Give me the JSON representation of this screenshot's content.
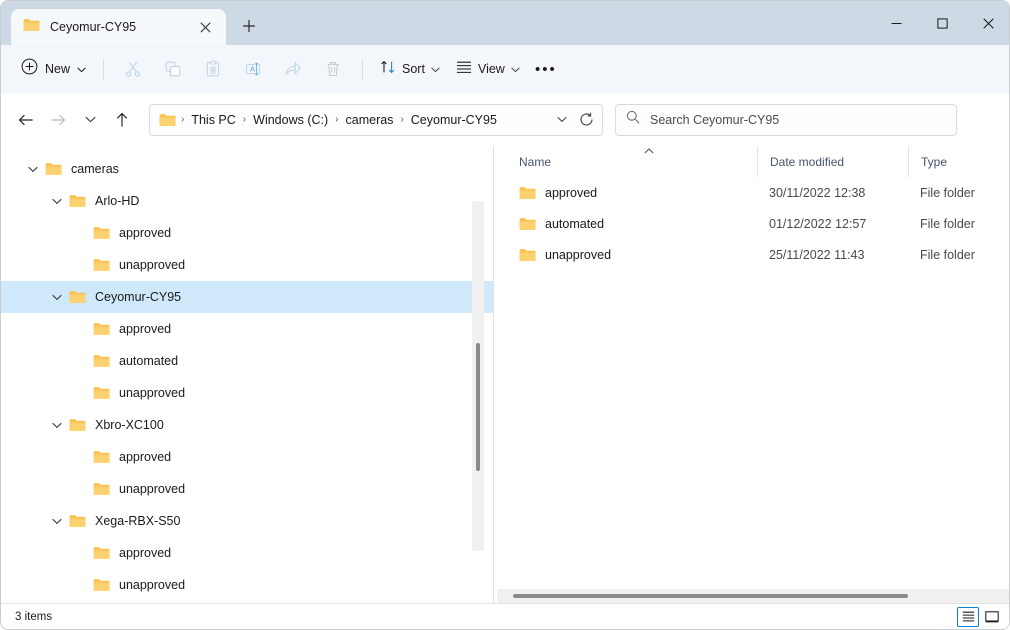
{
  "window": {
    "tab_title": "Ceyomur-CY95",
    "controls": {
      "minimize": "minimize-icon",
      "maximize": "maximize-icon",
      "close": "close-icon"
    },
    "new_tab_label": "+"
  },
  "toolbar": {
    "new_label": "New",
    "sort_label": "Sort",
    "view_label": "View",
    "more_label": "•••",
    "icons": [
      {
        "name": "cut-icon",
        "disabled": true
      },
      {
        "name": "copy-icon",
        "disabled": true
      },
      {
        "name": "paste-icon",
        "disabled": true
      },
      {
        "name": "rename-icon",
        "disabled": true
      },
      {
        "name": "share-icon",
        "disabled": true
      },
      {
        "name": "delete-icon",
        "disabled": true
      }
    ]
  },
  "address": {
    "back": "back-arrow-icon",
    "forward": "forward-arrow-icon",
    "recent": "chevron-down-icon",
    "up": "up-arrow-icon",
    "crumbs": [
      "This PC",
      "Windows (C:)",
      "cameras",
      "Ceyomur-CY95"
    ],
    "separator": "›",
    "refresh": "refresh-icon"
  },
  "search": {
    "placeholder": "Search Ceyomur-CY95",
    "value": ""
  },
  "sidebar": {
    "items": [
      {
        "label": "cameras",
        "depth": 0,
        "twisty": "expanded",
        "selected": false
      },
      {
        "label": "Arlo-HD",
        "depth": 1,
        "twisty": "expanded",
        "selected": false
      },
      {
        "label": "approved",
        "depth": 2,
        "twisty": "none",
        "selected": false
      },
      {
        "label": "unapproved",
        "depth": 2,
        "twisty": "none",
        "selected": false
      },
      {
        "label": "Ceyomur-CY95",
        "depth": 1,
        "twisty": "expanded",
        "selected": true
      },
      {
        "label": "approved",
        "depth": 2,
        "twisty": "none",
        "selected": false
      },
      {
        "label": "automated",
        "depth": 2,
        "twisty": "none",
        "selected": false
      },
      {
        "label": "unapproved",
        "depth": 2,
        "twisty": "none",
        "selected": false
      },
      {
        "label": "Xbro-XC100",
        "depth": 1,
        "twisty": "expanded",
        "selected": false
      },
      {
        "label": "approved",
        "depth": 2,
        "twisty": "none",
        "selected": false
      },
      {
        "label": "unapproved",
        "depth": 2,
        "twisty": "none",
        "selected": false
      },
      {
        "label": "Xega-RBX-S50",
        "depth": 1,
        "twisty": "expanded",
        "selected": false
      },
      {
        "label": "approved",
        "depth": 2,
        "twisty": "none",
        "selected": false
      },
      {
        "label": "unapproved",
        "depth": 2,
        "twisty": "none",
        "selected": false
      }
    ]
  },
  "filelist": {
    "columns": [
      "Name",
      "Date modified",
      "Type"
    ],
    "sort_column": "Name",
    "sort_direction": "ascending",
    "rows": [
      {
        "name": "approved",
        "date": "30/11/2022 12:38",
        "type": "File folder"
      },
      {
        "name": "automated",
        "date": "01/12/2022 12:57",
        "type": "File folder"
      },
      {
        "name": "unapproved",
        "date": "25/11/2022 11:43",
        "type": "File folder"
      }
    ]
  },
  "statusbar": {
    "item_count": "3 items",
    "details_view": "details-view-icon",
    "large_icons_view": "large-icons-view-icon"
  },
  "colors": {
    "titlebar": "#cdd9e5",
    "commandbar": "#f3f7fb",
    "selection": "#cfe8fa",
    "folder": "#fcc24c",
    "accent": "#0f7fd4"
  }
}
